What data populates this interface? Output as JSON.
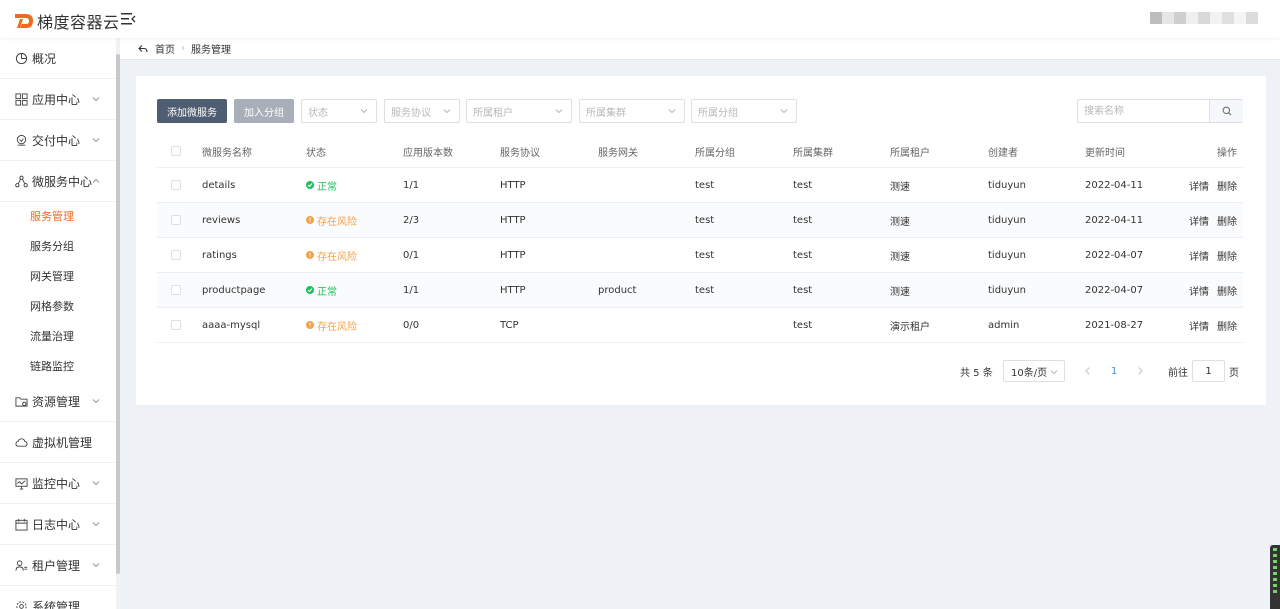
{
  "header": {
    "logo_mark": "D",
    "app_name": "梯度容器云"
  },
  "colors": {
    "brand": "#f06a1f",
    "primary_button": "#4f5d72",
    "status_ok": "#1fbf5c",
    "status_risk": "#f2a24a"
  },
  "sidebar": {
    "items": [
      {
        "label": "概况",
        "icon": "pie-chart-icon"
      },
      {
        "label": "应用中心",
        "icon": "grid-icon"
      },
      {
        "label": "交付中心",
        "icon": "delivery-icon"
      },
      {
        "label": "微服务中心",
        "icon": "network-icon"
      },
      {
        "label": "资源管理",
        "icon": "folder-icon"
      },
      {
        "label": "虚拟机管理",
        "icon": "cloud-icon"
      },
      {
        "label": "监控中心",
        "icon": "monitor-icon"
      },
      {
        "label": "日志中心",
        "icon": "calendar-icon"
      },
      {
        "label": "租户管理",
        "icon": "user-icon"
      },
      {
        "label": "系统管理",
        "icon": "gear-icon"
      }
    ],
    "sub_items": [
      "服务管理",
      "服务分组",
      "网关管理",
      "网格参数",
      "流量治理",
      "链路监控"
    ]
  },
  "breadcrumb": {
    "home": "首页",
    "current": "服务管理"
  },
  "toolbar": {
    "add_label": "添加微服务",
    "group_label": "加入分组",
    "filters": [
      "状态",
      "服务协议",
      "所属租户",
      "所属集群",
      "所属分组"
    ],
    "search_placeholder": "搜索名称"
  },
  "table": {
    "columns": [
      "微服务名称",
      "状态",
      "应用版本数",
      "服务协议",
      "服务网关",
      "所属分组",
      "所属集群",
      "所属租户",
      "创建者",
      "更新时间",
      "操作"
    ],
    "rows": [
      {
        "name": "details",
        "status": "正常",
        "status_type": "ok",
        "versions": "1/1",
        "protocol": "HTTP",
        "gateway": "",
        "group": "test",
        "cluster": "test",
        "tenant": "测速",
        "creator": "tiduyun",
        "updated": "2022-04-11",
        "op_detail": "详情",
        "op_delete": "删除"
      },
      {
        "name": "reviews",
        "status": "存在风险",
        "status_type": "risk",
        "versions": "2/3",
        "protocol": "HTTP",
        "gateway": "",
        "group": "test",
        "cluster": "test",
        "tenant": "测速",
        "creator": "tiduyun",
        "updated": "2022-04-11",
        "op_detail": "详情",
        "op_delete": "删除"
      },
      {
        "name": "ratings",
        "status": "存在风险",
        "status_type": "risk",
        "versions": "0/1",
        "protocol": "HTTP",
        "gateway": "",
        "group": "test",
        "cluster": "test",
        "tenant": "测速",
        "creator": "tiduyun",
        "updated": "2022-04-07",
        "op_detail": "详情",
        "op_delete": "删除"
      },
      {
        "name": "productpage",
        "status": "正常",
        "status_type": "ok",
        "versions": "1/1",
        "protocol": "HTTP",
        "gateway": "product",
        "group": "test",
        "cluster": "test",
        "tenant": "测速",
        "creator": "tiduyun",
        "updated": "2022-04-07",
        "op_detail": "详情",
        "op_delete": "删除"
      },
      {
        "name": "aaaa-mysql",
        "status": "存在风险",
        "status_type": "risk",
        "versions": "0/0",
        "protocol": "TCP",
        "gateway": "",
        "group": "",
        "cluster": "test",
        "tenant": "演示租户",
        "creator": "admin",
        "updated": "2021-08-27",
        "op_detail": "详情",
        "op_delete": "删除"
      }
    ]
  },
  "pagination": {
    "total": "共 5 条",
    "page_size": "10条/页",
    "current_page": "1",
    "jump_prefix": "前往",
    "jump_value": "1",
    "jump_suffix": "页"
  }
}
